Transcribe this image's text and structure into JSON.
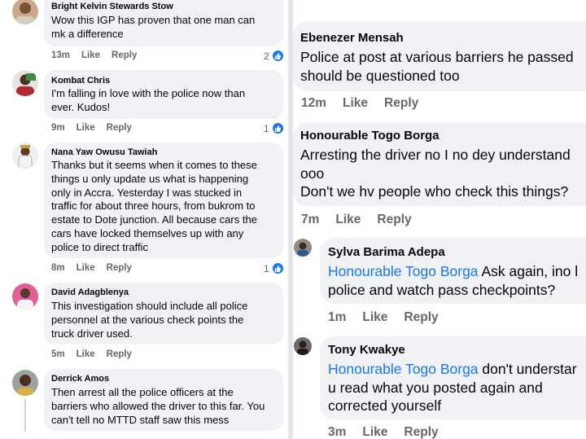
{
  "left_comments": [
    {
      "author": "Bright Kelvin Stewards Stow",
      "text": "Wow this IGP has proven that one man can\nmk a difference",
      "time": "13m",
      "like_label": "Like",
      "reply_label": "Reply",
      "reaction_count": "2"
    },
    {
      "author": "Kombat Chris",
      "text": "I'm falling in love with the police now than\never. Kudos!",
      "time": "9m",
      "like_label": "Like",
      "reply_label": "Reply",
      "reaction_count": "1"
    },
    {
      "author": "Nana Yaw Owusu Tawiah",
      "text": "Thanks but it seems when it comes to these\nthings u only update us what is happening\nonly in Accra. Yesterday I was stucked in\ntraffic for about three hours, from bukrom to\nestate to Dote junction. All  because cars the\ncars have locked themselves up with any\npolice to direct traffic",
      "time": "8m",
      "like_label": "Like",
      "reply_label": "Reply",
      "reaction_count": "1"
    },
    {
      "author": "David Adagblenya",
      "text": "This investigation should include all police\npersonnel at the various check points the\ntruck driver used.",
      "time": "5m",
      "like_label": "Like",
      "reply_label": "Reply",
      "reaction_count": ""
    },
    {
      "author": "Derrick Amos",
      "text": "Then arrest all the police officers at the\nbarriers who allowed the driver to this far. You\ncan't tell no MTTD staff saw this mess",
      "time": "",
      "like_label": "",
      "reply_label": "",
      "reaction_count": ""
    }
  ],
  "right_comments": [
    {
      "author": "Ebenezer Mensah",
      "text": "Police at post at various barriers he passed\nshould be questioned too",
      "time": "12m",
      "like_label": "Like",
      "reply_label": "Reply"
    },
    {
      "author": "Honourable Togo Borga",
      "text": "Arresting the driver no I no dey understand\nooo\nDon't we hv people who check this things?",
      "time": "7m",
      "like_label": "Like",
      "reply_label": "Reply"
    }
  ],
  "right_replies": [
    {
      "author": "Sylva Barima Adepa",
      "mention": "Honourable Togo Borga",
      "text": " Ask again, ino l\npolice and watch pass checkpoints?",
      "time": "1m",
      "like_label": "Like",
      "reply_label": "Reply"
    },
    {
      "author": "Tony Kwakye",
      "mention": "Honourable Togo Borga",
      "text": " don't understar\nu read what you posted again and\ncorrected yourself",
      "time": "3m",
      "like_label": "Like",
      "reply_label": "Reply"
    }
  ],
  "colors": {
    "bubble": "#f0f2f5",
    "link_blue": "#1877f2",
    "meta_gray": "#65676b",
    "divider": "#e4e6eb"
  }
}
